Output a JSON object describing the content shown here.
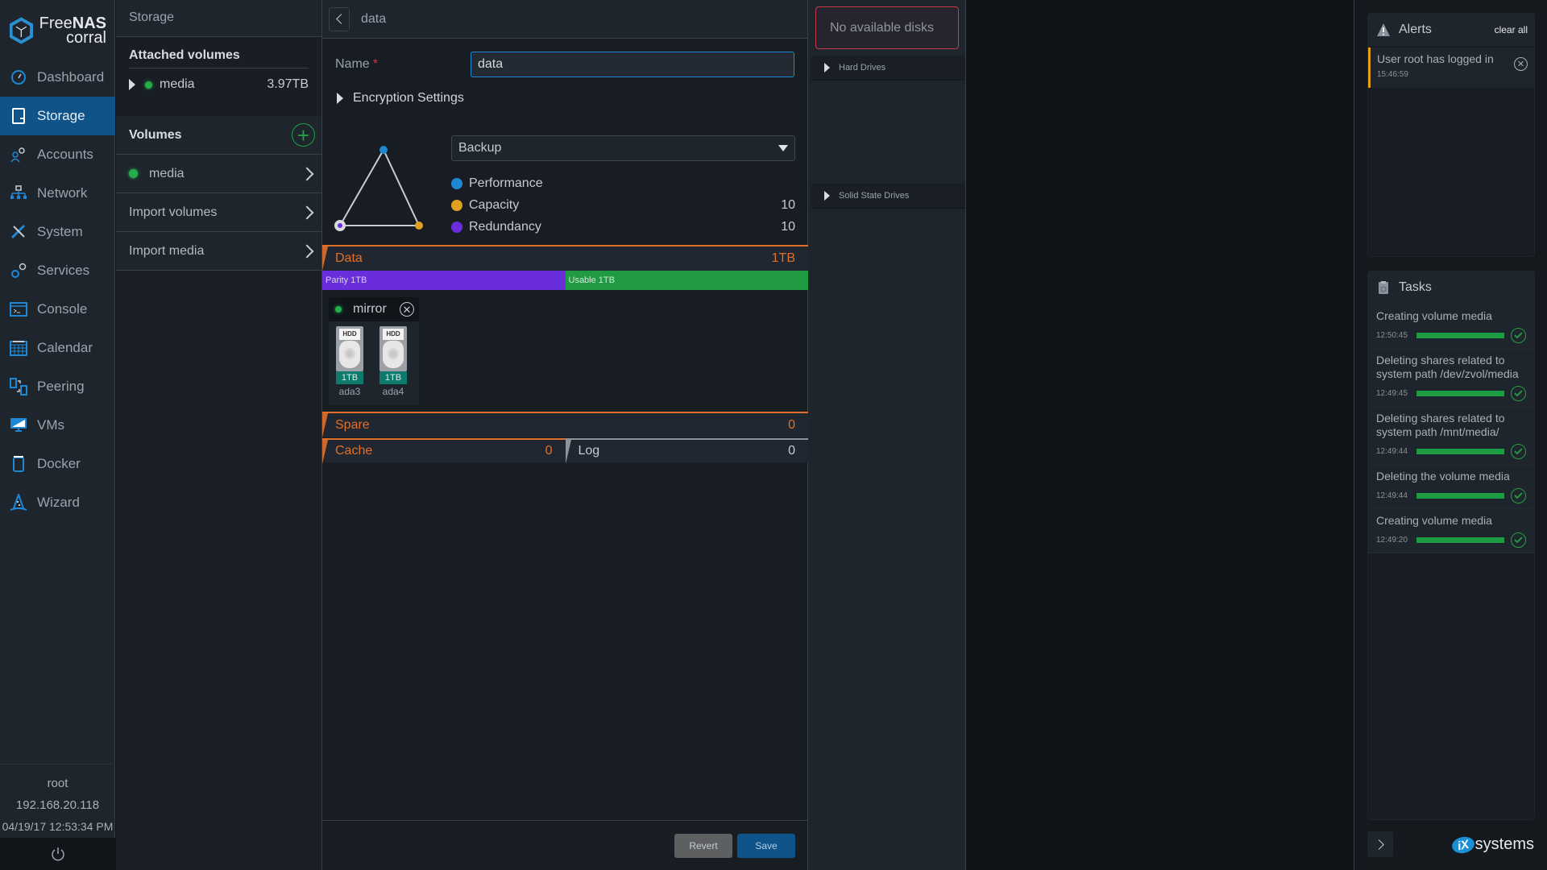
{
  "app": {
    "brand_line1_light": "Free",
    "brand_line1_bold": "NAS",
    "brand_line2": "corral"
  },
  "sidebar": {
    "items": [
      {
        "label": "Dashboard",
        "icon": "dashboard-gauge-icon",
        "active": false
      },
      {
        "label": "Storage",
        "icon": "storage-icon",
        "active": true
      },
      {
        "label": "Accounts",
        "icon": "accounts-users-icon",
        "active": false
      },
      {
        "label": "Network",
        "icon": "network-icon",
        "active": false
      },
      {
        "label": "System",
        "icon": "system-wrench-icon",
        "active": false
      },
      {
        "label": "Services",
        "icon": "services-gears-icon",
        "active": false
      },
      {
        "label": "Console",
        "icon": "console-terminal-icon",
        "active": false
      },
      {
        "label": "Calendar",
        "icon": "calendar-icon",
        "active": false
      },
      {
        "label": "Peering",
        "icon": "peering-icon",
        "active": false
      },
      {
        "label": "VMs",
        "icon": "vms-monitor-icon",
        "active": false
      },
      {
        "label": "Docker",
        "icon": "docker-container-icon",
        "active": false
      },
      {
        "label": "Wizard",
        "icon": "wizard-hat-icon",
        "active": false
      }
    ],
    "user": "root",
    "ip": "192.168.20.118",
    "datetime": "04/19/17  12:53:34 PM"
  },
  "storage": {
    "title": "Storage",
    "attached_title": "Attached volumes",
    "attached": [
      {
        "name": "media",
        "size": "3.97TB",
        "status": "online"
      }
    ],
    "volumes_title": "Volumes",
    "volumes": [
      {
        "name": "media",
        "status": "online"
      }
    ],
    "actions": [
      "Import volumes",
      "Import media"
    ]
  },
  "main": {
    "title": "data",
    "name_label": "Name",
    "name_required": "*",
    "name_value": "data",
    "encryption_label": "Encryption Settings",
    "preset": "Backup",
    "metrics": [
      {
        "label": "Performance",
        "value": "",
        "color": "#1e88d4"
      },
      {
        "label": "Capacity",
        "value": "10",
        "color": "#e0a020"
      },
      {
        "label": "Redundancy",
        "value": "10",
        "color": "#6a2ddb"
      }
    ],
    "data_label": "Data",
    "data_size": "1TB",
    "parity_label": "Parity 1TB",
    "usable_label": "Usable 1TB",
    "parity_fraction": 0.5,
    "vdev": {
      "type": "mirror",
      "disks": [
        {
          "name": "ada3",
          "size": "1TB",
          "kind": "HDD"
        },
        {
          "name": "ada4",
          "size": "1TB",
          "kind": "HDD"
        }
      ]
    },
    "spare_label": "Spare",
    "spare_value": "0",
    "cache_label": "Cache",
    "cache_value": "0",
    "log_label": "Log",
    "log_value": "0",
    "revert_label": "Revert",
    "save_label": "Save"
  },
  "disks_panel": {
    "empty_message": "No available disks",
    "groups": [
      "Hard Drives",
      "Solid State Drives"
    ]
  },
  "alerts": {
    "title": "Alerts",
    "clear_label": "clear all",
    "items": [
      {
        "text": "User root has logged in",
        "time": "15:46:59"
      }
    ]
  },
  "tasks": {
    "title": "Tasks",
    "items": [
      {
        "text": "Creating volume media",
        "time": "12:50:45",
        "progress": 100
      },
      {
        "text": "Deleting shares related to system path /dev/zvol/media",
        "time": "12:49:45",
        "progress": 100
      },
      {
        "text": "Deleting shares related to system path /mnt/media/",
        "time": "12:49:44",
        "progress": 100
      },
      {
        "text": "Deleting the volume media",
        "time": "12:49:44",
        "progress": 100
      },
      {
        "text": "Creating volume media",
        "time": "12:49:20",
        "progress": 100
      }
    ]
  },
  "footer_brand": {
    "badge": "iX",
    "text": "systems"
  }
}
